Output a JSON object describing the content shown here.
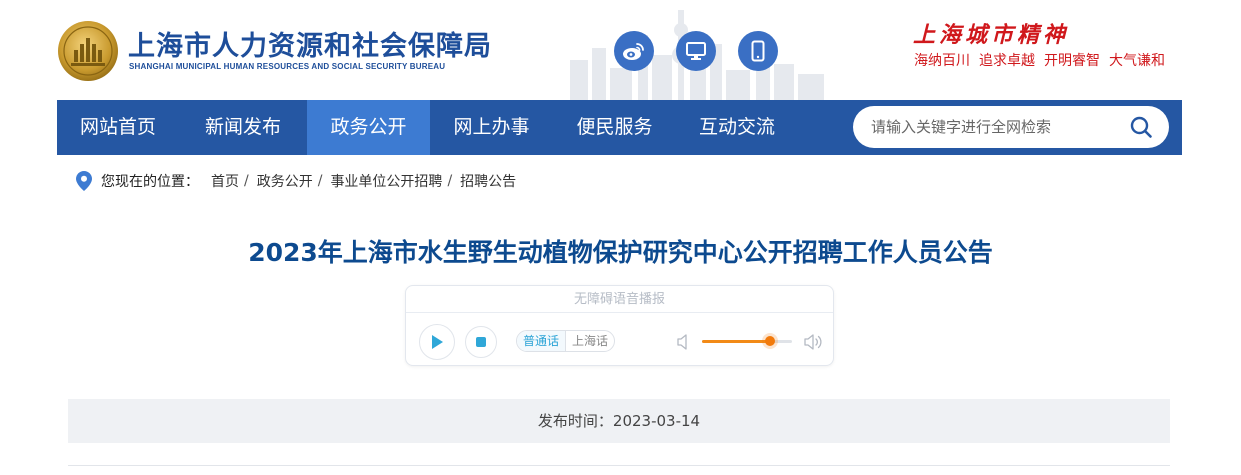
{
  "header": {
    "org_name_cn": "上海市人力资源和社会保障局",
    "org_name_en": "SHANGHAI MUNICIPAL HUMAN RESOURCES AND SOCIAL SECURITY BUREAU",
    "quick_links": [
      {
        "icon": "weibo-icon"
      },
      {
        "icon": "desktop-icon"
      },
      {
        "icon": "mobile-icon"
      }
    ],
    "spirit_title": "上海城市精神",
    "spirit_tags": [
      "海纳百川",
      "追求卓越",
      "开明睿智",
      "大气谦和"
    ]
  },
  "nav": {
    "items": [
      {
        "label": "网站首页"
      },
      {
        "label": "新闻发布"
      },
      {
        "label": "政务公开"
      },
      {
        "label": "网上办事"
      },
      {
        "label": "便民服务"
      },
      {
        "label": "互动交流"
      }
    ],
    "active": "政务公开",
    "search_placeholder": "请输入关键字进行全网检索"
  },
  "breadcrumb": {
    "label": "您现在的位置：",
    "items": [
      "首页",
      "政务公开",
      "事业单位公开招聘",
      "招聘公告"
    ],
    "separator": "/"
  },
  "article": {
    "title": "2023年上海市水生野生动植物保护研究中心公开招聘工作人员公告",
    "publish_label": "发布时间：",
    "publish_date": "2023-03-14",
    "publish_text": "发布时间：2023-03-14"
  },
  "player": {
    "header": "无障碍语音播报",
    "languages": [
      "普通话",
      "上海话"
    ],
    "active_language": "普通话",
    "volume": 0.75
  },
  "colors": {
    "brand_blue": "#2557a3",
    "nav_active": "#3d7bd2",
    "title_blue": "#0d4a8f",
    "spirit_red": "#d0181c",
    "volume_orange": "#f28a17"
  }
}
